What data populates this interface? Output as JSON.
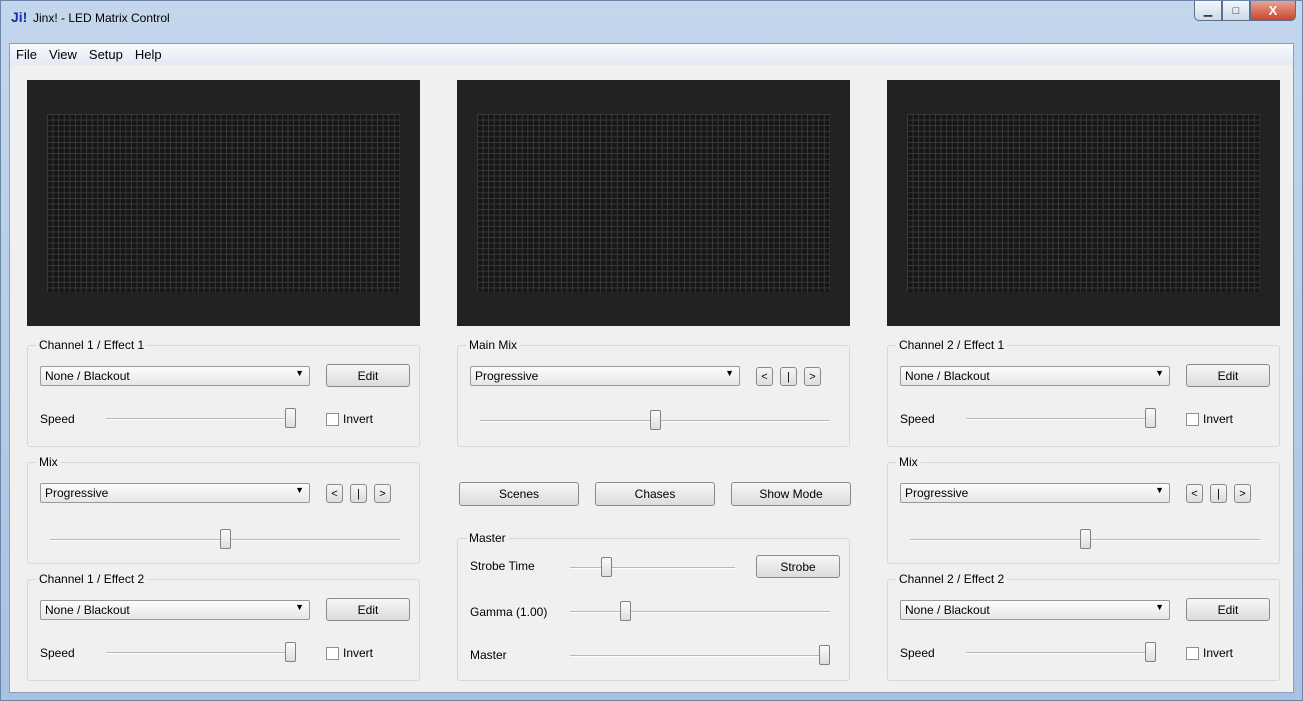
{
  "window": {
    "logo": "Ji!",
    "title": "Jinx! - LED Matrix Control",
    "buttons": {
      "minimize": "▁",
      "maximize": "□",
      "close": "X"
    }
  },
  "menu": [
    "File",
    "View",
    "Setup",
    "Help"
  ],
  "left": {
    "effect1": {
      "title": "Channel 1 / Effect 1",
      "effect": "None / Blackout",
      "edit": "Edit",
      "speed_label": "Speed",
      "speed": 1.0,
      "invert": "Invert"
    },
    "mix": {
      "title": "Mix",
      "mode": "Progressive",
      "prev": "<",
      "pause": "|",
      "next": ">",
      "level": 0.5
    },
    "effect2": {
      "title": "Channel 1 / Effect 2",
      "effect": "None / Blackout",
      "edit": "Edit",
      "speed_label": "Speed",
      "speed": 1.0,
      "invert": "Invert"
    }
  },
  "center": {
    "main_mix": {
      "title": "Main Mix",
      "mode": "Progressive",
      "prev": "<",
      "pause": "|",
      "next": ">",
      "level": 0.5
    },
    "buttons": {
      "scenes": "Scenes",
      "chases": "Chases",
      "show_mode": "Show Mode"
    },
    "master": {
      "title": "Master",
      "strobe_time_label": "Strobe Time",
      "strobe_time": 0.2,
      "strobe": "Strobe",
      "gamma_label": "Gamma (1.00)",
      "gamma": 0.2,
      "master_label": "Master",
      "master": 1.0
    }
  },
  "right": {
    "effect1": {
      "title": "Channel 2 / Effect 1",
      "effect": "None / Blackout",
      "edit": "Edit",
      "speed_label": "Speed",
      "speed": 1.0,
      "invert": "Invert"
    },
    "mix": {
      "title": "Mix",
      "mode": "Progressive",
      "prev": "<",
      "pause": "|",
      "next": ">",
      "level": 0.5
    },
    "effect2": {
      "title": "Channel 2 / Effect 2",
      "effect": "None / Blackout",
      "edit": "Edit",
      "speed_label": "Speed",
      "speed": 1.0,
      "invert": "Invert"
    }
  }
}
